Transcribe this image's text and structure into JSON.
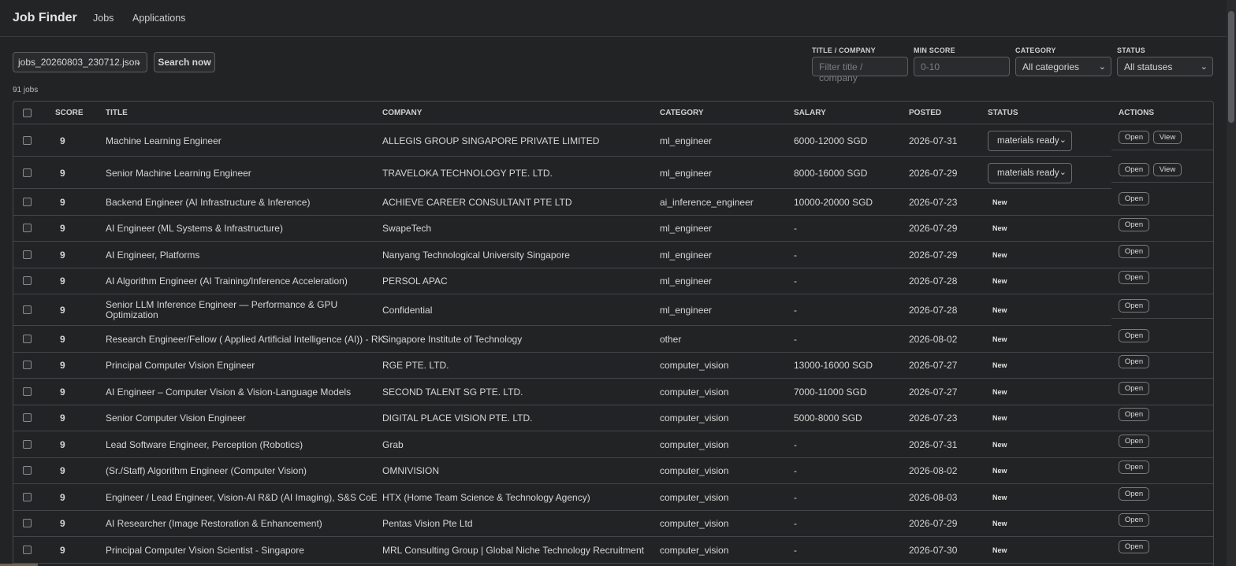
{
  "app": {
    "title": "Job Finder",
    "nav": [
      {
        "label": "Jobs"
      },
      {
        "label": "Applications"
      }
    ]
  },
  "toolbar": {
    "file_select": "jobs_20260803_230712.json",
    "search_label": "Search now"
  },
  "filters": {
    "title_label": "TITLE / COMPANY",
    "title_placeholder": "Filter title / company",
    "score_label": "MIN SCORE",
    "score_placeholder": "0-10",
    "category_label": "CATEGORY",
    "category_value": "All categories",
    "status_label": "STATUS",
    "status_value": "All statuses"
  },
  "job_count": "91 jobs",
  "table": {
    "headers": [
      "SCORE",
      "TITLE",
      "COMPANY",
      "CATEGORY",
      "SALARY",
      "POSTED",
      "STATUS",
      "ACTIONS"
    ],
    "open_label": "Open",
    "view_label": "View",
    "rows": [
      {
        "score": "9",
        "title": "Machine Learning Engineer",
        "company": "ALLEGIS GROUP SINGAPORE PRIVATE LIMITED",
        "category": "ml_engineer",
        "salary": "6000-12000 SGD",
        "posted": "2026-07-31",
        "status": "materials ready"
      },
      {
        "score": "9",
        "title": "Senior Machine Learning Engineer",
        "company": "TRAVELOKA TECHNOLOGY PTE. LTD.",
        "category": "ml_engineer",
        "salary": "8000-16000 SGD",
        "posted": "2026-07-29",
        "status": "materials ready"
      },
      {
        "score": "9",
        "title": "Backend Engineer (AI Infrastructure & Inference)",
        "company": "ACHIEVE CAREER CONSULTANT PTE LTD",
        "category": "ai_inference_engineer",
        "salary": "10000-20000 SGD",
        "posted": "2026-07-23",
        "status": "New"
      },
      {
        "score": "9",
        "title": "AI Engineer (ML Systems & Infrastructure)",
        "company": "SwapeTech",
        "category": "ml_engineer",
        "salary": "-",
        "posted": "2026-07-29",
        "status": "New"
      },
      {
        "score": "9",
        "title": "AI Engineer, Platforms",
        "company": "Nanyang Technological University Singapore",
        "category": "ml_engineer",
        "salary": "-",
        "posted": "2026-07-29",
        "status": "New"
      },
      {
        "score": "9",
        "title": "AI Algorithm Engineer (AI Training/Inference Acceleration)",
        "company": "PERSOL APAC",
        "category": "ml_engineer",
        "salary": "-",
        "posted": "2026-07-28",
        "status": "New"
      },
      {
        "score": "9",
        "title_line1": "Senior LLM Inference Engineer — Performance & GPU",
        "title_line2": "Optimization",
        "company": "Confidential",
        "category": "ml_engineer",
        "salary": "-",
        "posted": "2026-07-28",
        "status": "New"
      },
      {
        "score": "9",
        "title": "Research Engineer/Fellow ( Applied Artificial Intelligence (AI)) - RK",
        "company": "Singapore Institute of Technology",
        "category": "other",
        "salary": "-",
        "posted": "2026-08-02",
        "status": "New"
      },
      {
        "score": "9",
        "title": "Principal Computer Vision Engineer",
        "company": "RGE PTE. LTD.",
        "category": "computer_vision",
        "salary": "13000-16000 SGD",
        "posted": "2026-07-27",
        "status": "New"
      },
      {
        "score": "9",
        "title": "AI Engineer – Computer Vision & Vision-Language Models",
        "company": "SECOND TALENT SG PTE. LTD.",
        "category": "computer_vision",
        "salary": "7000-11000 SGD",
        "posted": "2026-07-27",
        "status": "New"
      },
      {
        "score": "9",
        "title": "Senior Computer Vision Engineer",
        "company": "DIGITAL PLACE VISION PTE. LTD.",
        "category": "computer_vision",
        "salary": "5000-8000 SGD",
        "posted": "2026-07-23",
        "status": "New"
      },
      {
        "score": "9",
        "title": "Lead Software Engineer, Perception (Robotics)",
        "company": "Grab",
        "category": "computer_vision",
        "salary": "-",
        "posted": "2026-07-31",
        "status": "New"
      },
      {
        "score": "9",
        "title": "(Sr./Staff) Algorithm Engineer (Computer Vision)",
        "company": "OMNIVISION",
        "category": "computer_vision",
        "salary": "-",
        "posted": "2026-08-02",
        "status": "New"
      },
      {
        "score": "9",
        "title": "Engineer / Lead Engineer, Vision-AI R&D (AI Imaging), S&S CoE",
        "company": "HTX (Home Team Science & Technology Agency)",
        "category": "computer_vision",
        "salary": "-",
        "posted": "2026-08-03",
        "status": "New"
      },
      {
        "score": "9",
        "title": "AI Researcher (Image Restoration & Enhancement)",
        "company": "Pentas Vision Pte Ltd",
        "category": "computer_vision",
        "salary": "-",
        "posted": "2026-07-29",
        "status": "New"
      },
      {
        "score": "9",
        "title": "Principal Computer Vision Scientist - Singapore",
        "company": "MRL Consulting Group | Global Niche Technology Recruitment",
        "category": "computer_vision",
        "salary": "-",
        "posted": "2026-07-30",
        "status": "New"
      }
    ]
  }
}
